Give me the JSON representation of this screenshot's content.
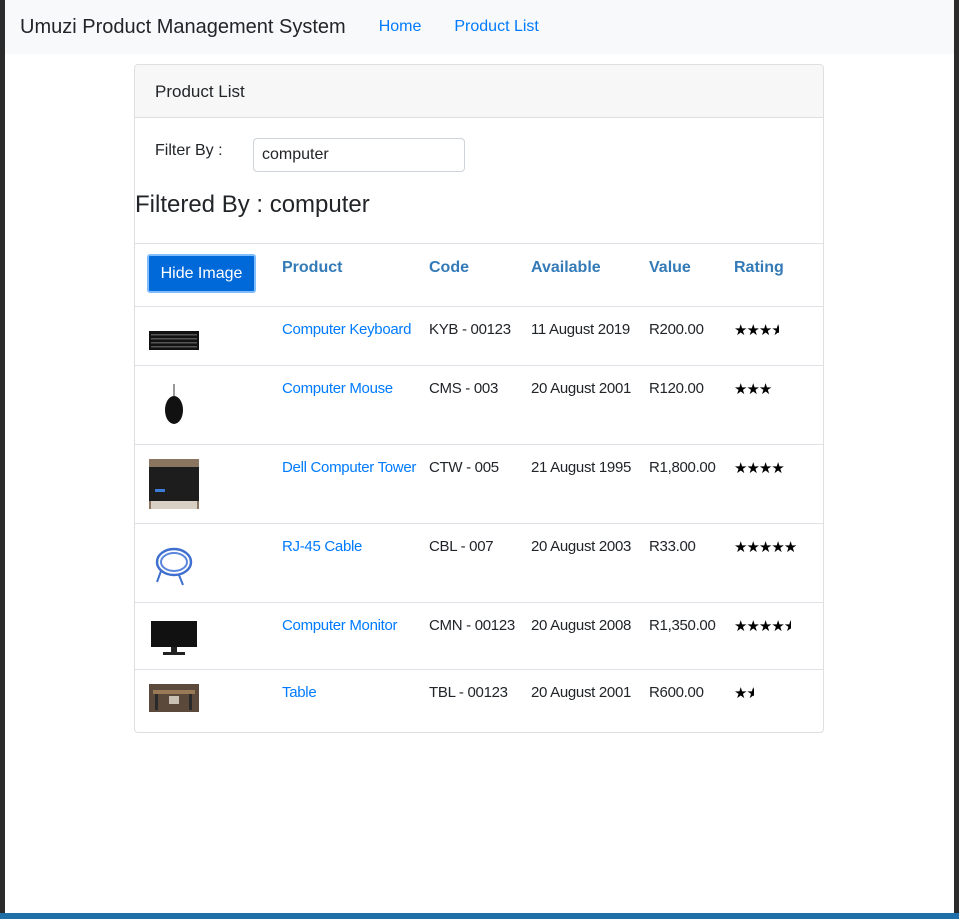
{
  "navbar": {
    "brand": "Umuzi Product Management System",
    "links": [
      "Home",
      "Product List"
    ]
  },
  "card": {
    "header": "Product List",
    "filter_label": "Filter By :",
    "filter_value": "computer",
    "filtered_heading": "Filtered By : computer"
  },
  "table": {
    "button_label": "Hide Image",
    "columns": [
      "Product",
      "Code",
      "Available",
      "Value",
      "Rating"
    ],
    "rows": [
      {
        "image": "keyboard",
        "product": "Computer Keyboard",
        "code": "KYB - 00123",
        "available": "11 August 2019",
        "value": "R200.00",
        "rating": 3.5
      },
      {
        "image": "mouse",
        "product": "Computer Mouse",
        "code": "CMS - 003",
        "available": "20 August 2001",
        "value": "R120.00",
        "rating": 3
      },
      {
        "image": "tower",
        "product": "Dell Computer Tower",
        "code": "CTW - 005",
        "available": "21 August 1995",
        "value": "R1,800.00",
        "rating": 4
      },
      {
        "image": "cable",
        "product": "RJ-45 Cable",
        "code": "CBL - 007",
        "available": "20 August 2003",
        "value": "R33.00",
        "rating": 5
      },
      {
        "image": "monitor",
        "product": "Computer Monitor",
        "code": "CMN - 00123",
        "available": "20 August 2008",
        "value": "R1,350.00",
        "rating": 4.5
      },
      {
        "image": "table",
        "product": "Table",
        "code": "TBL - 00123",
        "available": "20 August 2001",
        "value": "R600.00",
        "rating": 1.5
      }
    ]
  },
  "colors": {
    "link": "#007bff",
    "header_link": "#337ab7",
    "button": "#0069d9"
  }
}
